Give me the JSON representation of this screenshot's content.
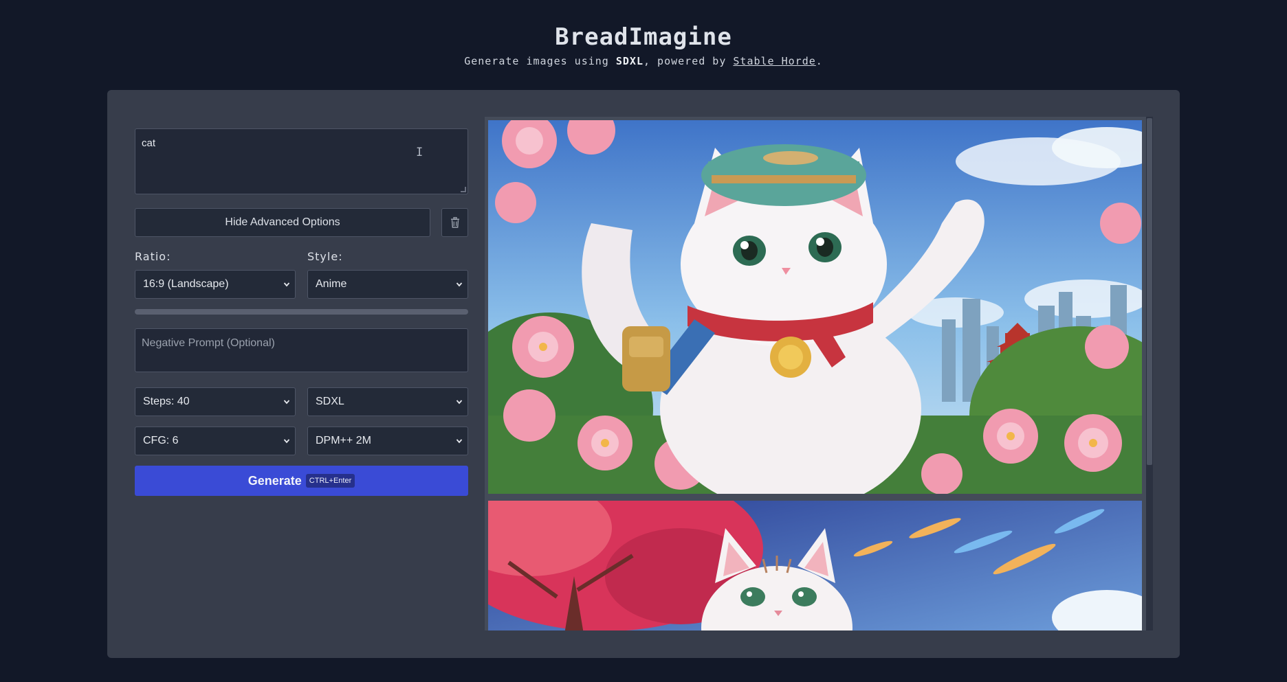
{
  "header": {
    "title": "BreadImagine",
    "subtitle_prefix": "Generate images using ",
    "subtitle_model": "SDXL",
    "subtitle_mid": ", powered by ",
    "subtitle_link": "Stable Horde",
    "subtitle_suffix": "."
  },
  "form": {
    "prompt_value": "cat",
    "hide_advanced_label": "Hide Advanced Options",
    "ratio_label": "Ratio:",
    "ratio_value": "16:9 (Landscape)",
    "style_label": "Style:",
    "style_value": "Anime",
    "negative_placeholder": "Negative Prompt (Optional)",
    "steps_value": "Steps: 40",
    "model_value": "SDXL",
    "cfg_value": "CFG: 6",
    "sampler_value": "DPM++ 2M",
    "generate_label": "Generate",
    "generate_shortcut": "CTRL+Enter"
  },
  "gallery": {
    "images": [
      "anime white cat with teal cap and red scarf among pink flowers and city skyline",
      "anime white cat under red blossom tree with blue sky"
    ]
  },
  "icons": {
    "trash": "trash-icon",
    "chevron": "chevron-down-icon",
    "text_cursor": "text-cursor-icon"
  },
  "colors": {
    "background": "#121828",
    "panel": "#373d4b",
    "accent": "#3a4bd6"
  }
}
